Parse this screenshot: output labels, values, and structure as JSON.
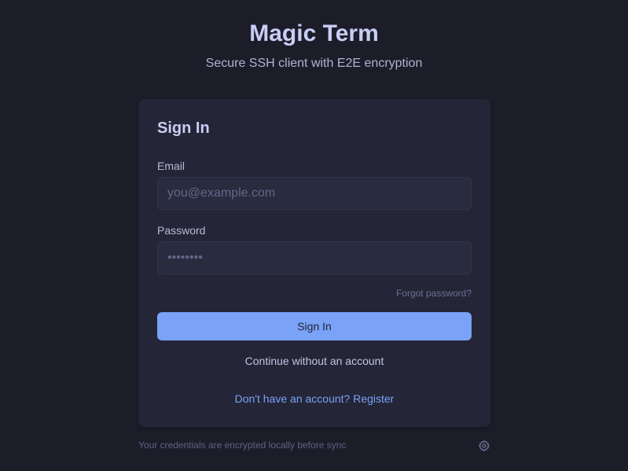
{
  "header": {
    "title": "Magic Term",
    "subtitle": "Secure SSH client with E2E encryption"
  },
  "signin_card": {
    "title": "Sign In",
    "email": {
      "label": "Email",
      "placeholder": "you@example.com",
      "value": ""
    },
    "password": {
      "label": "Password",
      "placeholder": "••••••••",
      "value": ""
    },
    "forgot_password_label": "Forgot password?",
    "submit_label": "Sign In",
    "continue_label": "Continue without an account",
    "register_label": "Don't have an account? Register"
  },
  "footer": {
    "note": "Your credentials are encrypted locally before sync",
    "settings_icon": "gear-icon"
  },
  "colors": {
    "background": "#1d1d2a",
    "card": "#242536",
    "accent": "#7aa2f7",
    "title": "#c8cdf5"
  }
}
